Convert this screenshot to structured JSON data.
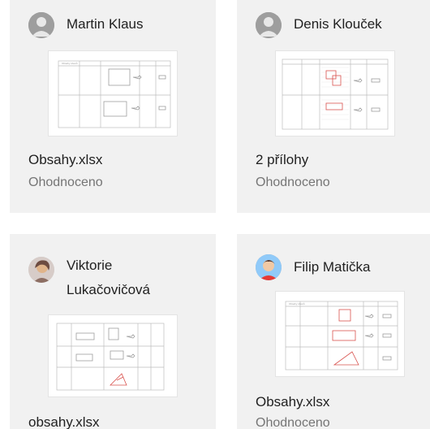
{
  "submissions": [
    {
      "student": "Martin Klaus",
      "attachment": "Obsahy.xlsx",
      "status": "Ohodnoceno",
      "avatar": "default-avatar-icon"
    },
    {
      "student": "Denis Klouček",
      "attachment": "2 přílohy",
      "status": "Ohodnoceno",
      "avatar": "default-avatar-icon"
    },
    {
      "student_line1": "Viktorie",
      "student_line2": "Lukačovičová",
      "attachment": "obsahy.xlsx",
      "status": "",
      "avatar": "photo-avatar"
    },
    {
      "student": "Filip Matička",
      "attachment": "Obsahy.xlsx",
      "status": "Ohodnoceno",
      "avatar": "photo-avatar"
    }
  ],
  "colors": {
    "card_bg": "#f1f1f1",
    "text_primary": "#212121",
    "text_secondary": "#757575",
    "sketch_red": "#d9534f"
  }
}
